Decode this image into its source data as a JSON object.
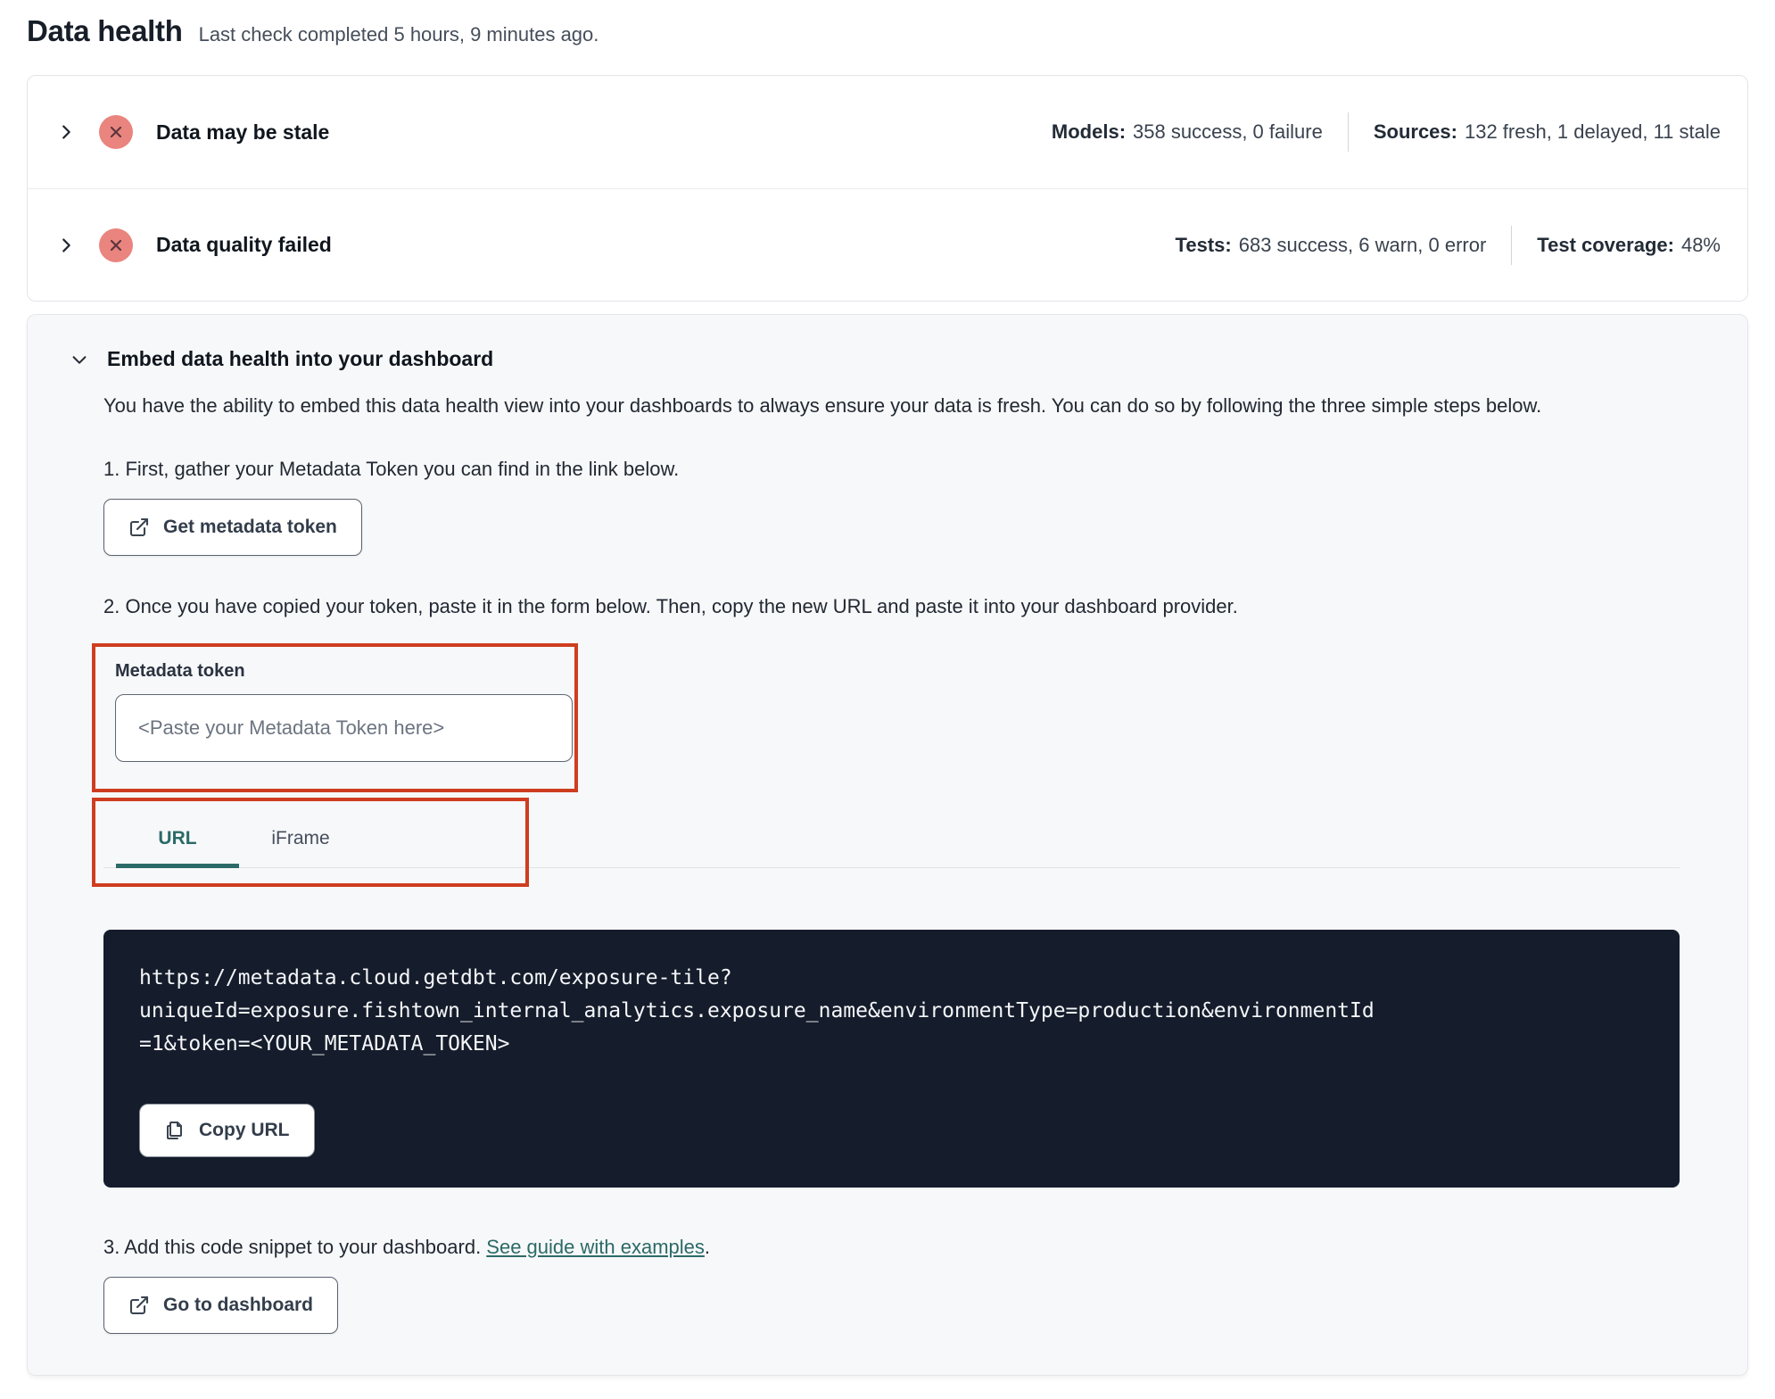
{
  "page": {
    "title": "Data health",
    "subtitle": "Last check completed 5 hours, 9 minutes ago."
  },
  "status_rows": [
    {
      "label": "Data may be stale",
      "status": "error",
      "metrics": [
        {
          "label": "Models:",
          "value": "358 success, 0 failure"
        },
        {
          "label": "Sources:",
          "value": "132 fresh, 1 delayed, 11 stale"
        }
      ]
    },
    {
      "label": "Data quality failed",
      "status": "error",
      "metrics": [
        {
          "label": "Tests:",
          "value": "683 success, 6 warn, 0 error"
        },
        {
          "label": "Test coverage:",
          "value": "48%"
        }
      ]
    }
  ],
  "embed": {
    "title": "Embed data health into your dashboard",
    "description": "You have the ability to embed this data health view into your dashboards to always ensure your data is fresh. You can do so by following the three simple steps below.",
    "steps": {
      "step1_text": "1. First, gather your Metadata Token you can find in the link below.",
      "get_token_button": "Get metadata token",
      "step2_text": "2. Once you have copied your token, paste it in the form below. Then, copy the new URL and paste it into your dashboard provider.",
      "token_field_label": "Metadata token",
      "token_placeholder": "<Paste your Metadata Token here>",
      "step3_prefix": "3. Add this code snippet to your dashboard. ",
      "step3_link": "See guide with examples",
      "step3_suffix": ".",
      "dashboard_button": "Go to dashboard"
    },
    "tabs": [
      {
        "label": "URL",
        "active": true
      },
      {
        "label": "iFrame",
        "active": false
      }
    ],
    "code_url": "https://metadata.cloud.getdbt.com/exposure-tile?\nuniqueId=exposure.fishtown_internal_analytics.exposure_name&environmentType=production&environmentId\n=1&token=<YOUR_METADATA_TOKEN>",
    "copy_button": "Copy URL"
  },
  "colors": {
    "error_icon": "#e9857e",
    "accent_teal": "#2b6a67",
    "annotation_red": "#ce3d1f",
    "code_background": "#151c2b"
  }
}
